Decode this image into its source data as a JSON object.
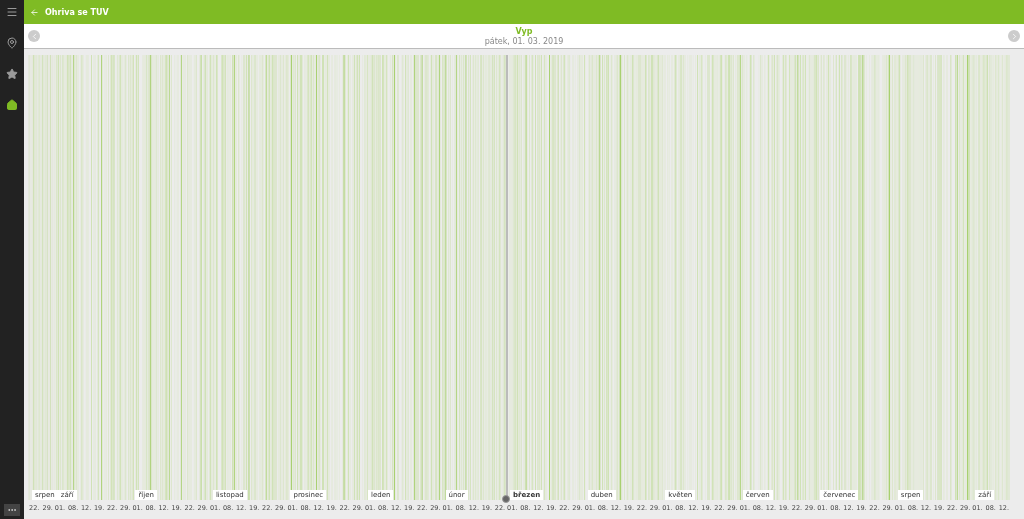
{
  "sidebar": {
    "items": [
      {
        "kind": "pin",
        "selected": false
      },
      {
        "kind": "star",
        "selected": false
      },
      {
        "kind": "home",
        "selected": true
      }
    ]
  },
  "top_bar": {
    "title": "Ohriva se TUV"
  },
  "header": {
    "state": "Vyp",
    "date": "pátek, 01. 03. 2019"
  },
  "timeline": {
    "months": [
      {
        "label": "srpen",
        "selected": false,
        "ticks": [
          "22.",
          "29."
        ]
      },
      {
        "label": "září",
        "selected": false,
        "ticks": [
          "01.",
          "08.",
          "12.",
          "19.",
          "22.",
          "29."
        ]
      },
      {
        "label": "říjen",
        "selected": false,
        "ticks": [
          "01.",
          "08.",
          "12.",
          "19.",
          "22.",
          "29."
        ]
      },
      {
        "label": "listopad",
        "selected": false,
        "ticks": [
          "01.",
          "08.",
          "12.",
          "19.",
          "22.",
          "29."
        ]
      },
      {
        "label": "prosinec",
        "selected": false,
        "ticks": [
          "01.",
          "08.",
          "12.",
          "19.",
          "22.",
          "29."
        ]
      },
      {
        "label": "leden",
        "selected": false,
        "ticks": [
          "01.",
          "08.",
          "12.",
          "19.",
          "22.",
          "29."
        ]
      },
      {
        "label": "únor",
        "selected": false,
        "ticks": [
          "01.",
          "08.",
          "12.",
          "19.",
          "22."
        ]
      },
      {
        "label": "březen",
        "selected": true,
        "ticks": [
          "01.",
          "08.",
          "12.",
          "19.",
          "22.",
          "29."
        ]
      },
      {
        "label": "duben",
        "selected": false,
        "ticks": [
          "01.",
          "08.",
          "12.",
          "19.",
          "22.",
          "29."
        ]
      },
      {
        "label": "květen",
        "selected": false,
        "ticks": [
          "01.",
          "08.",
          "12.",
          "19.",
          "22.",
          "29."
        ]
      },
      {
        "label": "červen",
        "selected": false,
        "ticks": [
          "01.",
          "08.",
          "12.",
          "19.",
          "22.",
          "29."
        ]
      },
      {
        "label": "červenec",
        "selected": false,
        "ticks": [
          "01.",
          "08.",
          "12.",
          "19.",
          "22.",
          "29."
        ]
      },
      {
        "label": "srpen",
        "selected": false,
        "ticks": [
          "01.",
          "08.",
          "12.",
          "19.",
          "22.",
          "29."
        ]
      },
      {
        "label": "září",
        "selected": false,
        "ticks": [
          "01.",
          "08.",
          "12."
        ]
      }
    ]
  }
}
